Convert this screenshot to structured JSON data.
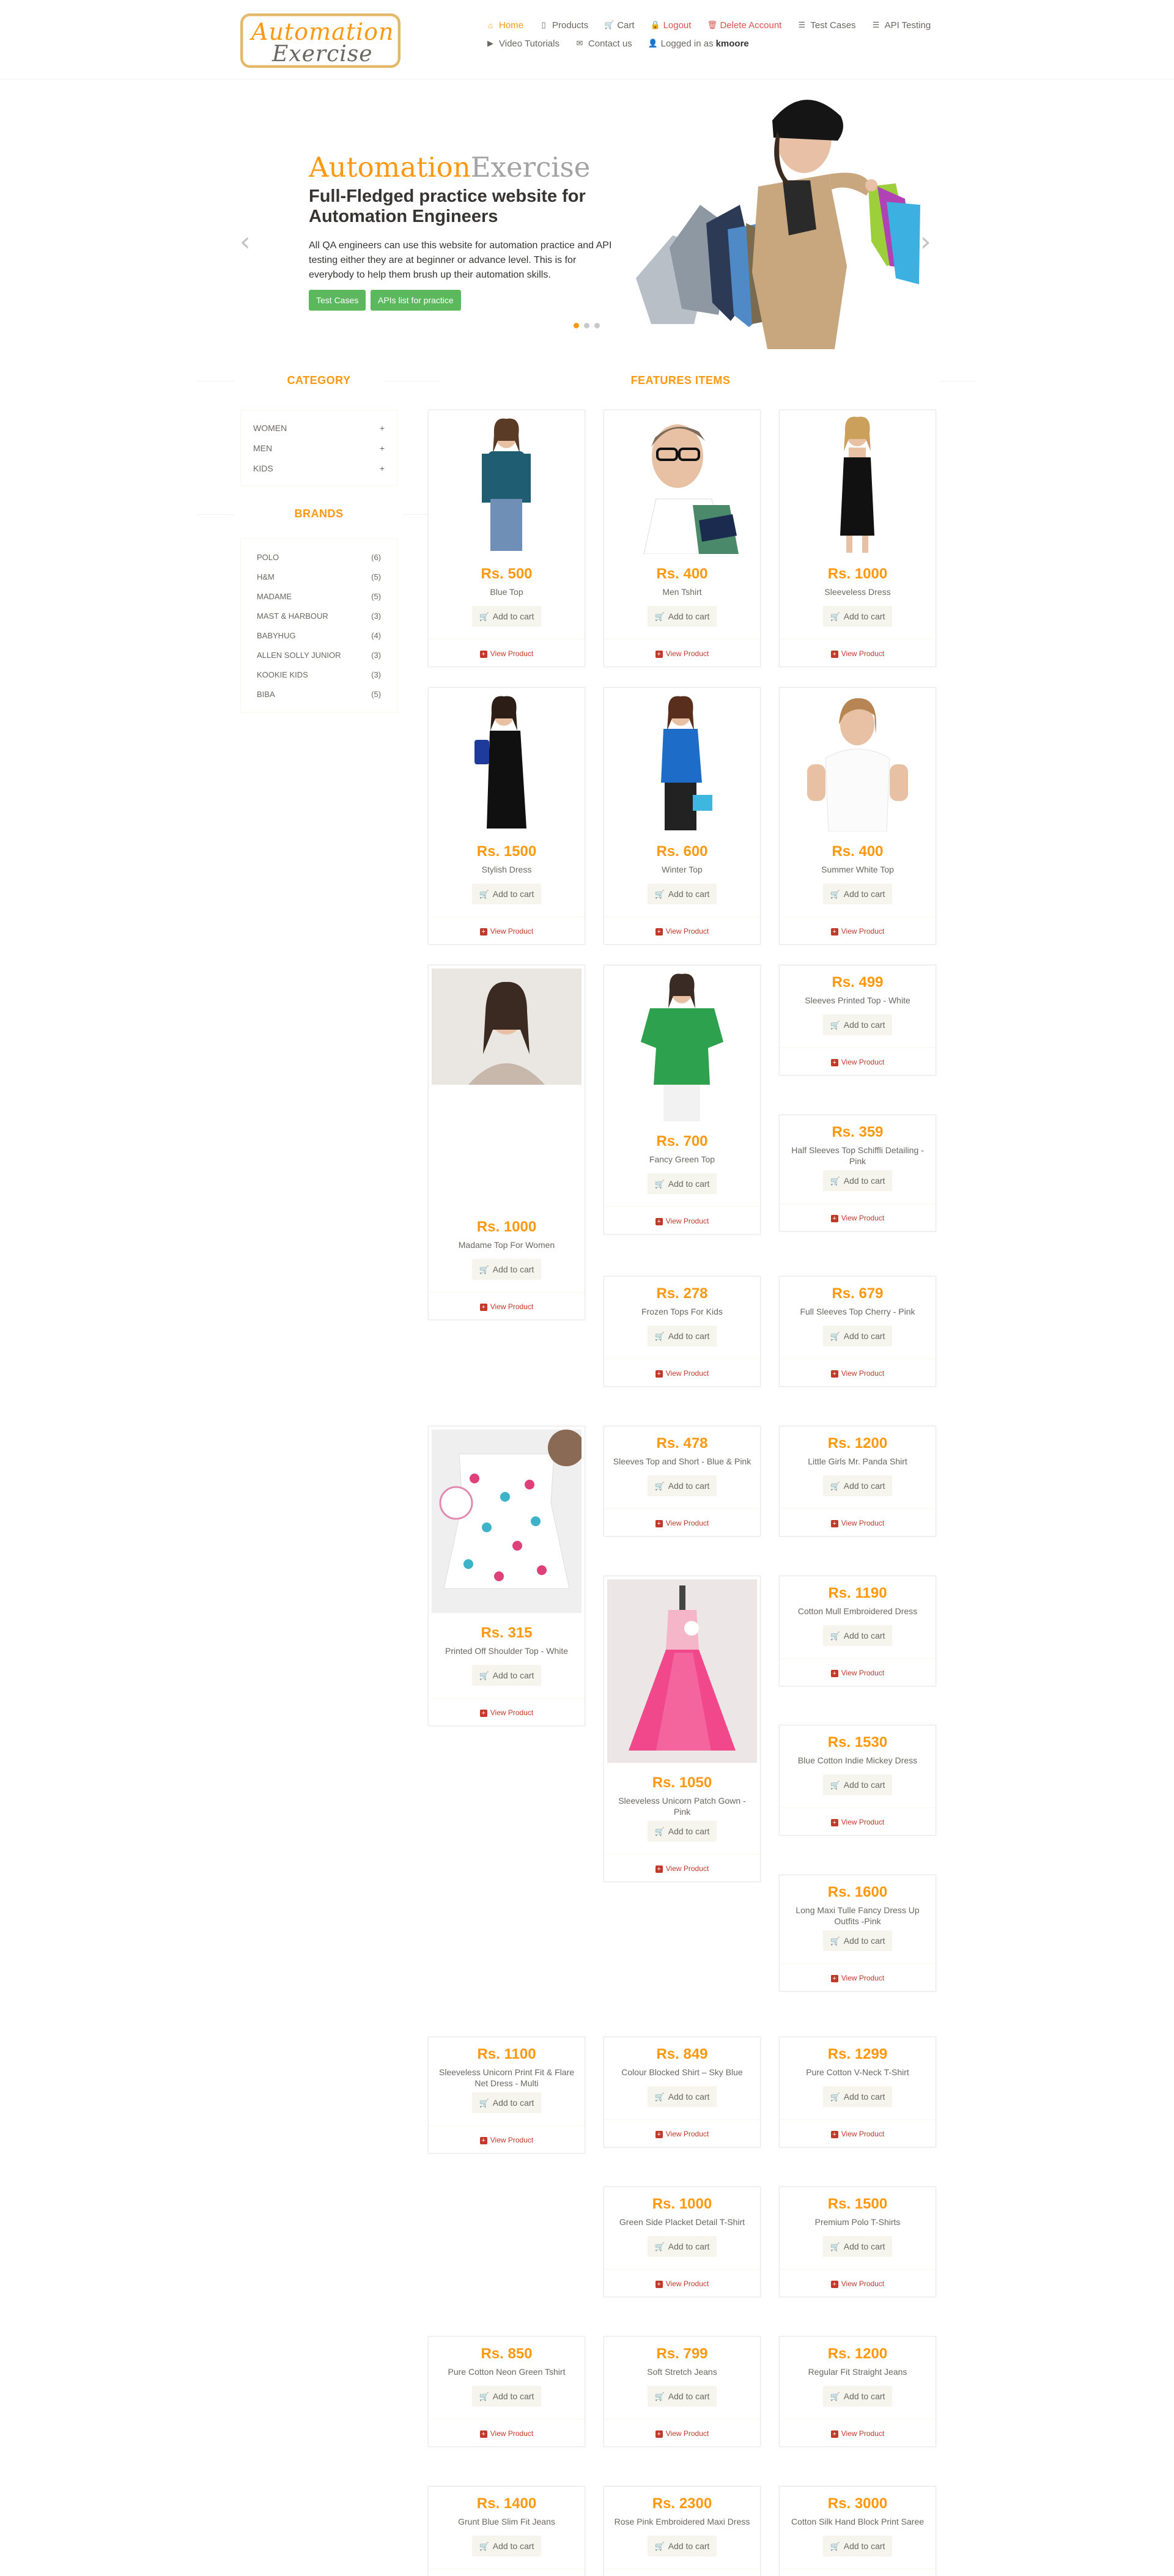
{
  "header": {
    "logo": {
      "line1": "Automation",
      "line2": "Exercise"
    },
    "nav": [
      {
        "label": "Home",
        "icon": "home-icon",
        "glyph": "⌂"
      },
      {
        "label": "Products",
        "icon": "shirt-icon",
        "glyph": "▯"
      },
      {
        "label": "Cart",
        "icon": "cart-icon",
        "glyph": "🛒"
      },
      {
        "label": "Logout",
        "icon": "lock-icon",
        "glyph": "🔒"
      },
      {
        "label": "Delete Account",
        "icon": "trash-icon",
        "glyph": "🗑"
      },
      {
        "label": "Test Cases",
        "icon": "list-icon",
        "glyph": "☰"
      },
      {
        "label": "API Testing",
        "icon": "list-icon",
        "glyph": "☰"
      },
      {
        "label": "Video Tutorials",
        "icon": "youtube-icon",
        "glyph": "▶"
      },
      {
        "label": "Contact us",
        "icon": "envelope-icon",
        "glyph": "✉"
      },
      {
        "label": "Logged in as",
        "icon": "user-icon",
        "glyph": "👤",
        "user": "kmoore"
      }
    ]
  },
  "slider": {
    "brand_a": "Automation",
    "brand_b": "Exercise",
    "heading": "Full-Fledged practice website for Automation Engineers",
    "text": "All QA engineers can use this website for automation practice and API testing either they are at beginner or advance level. This is for everybody to help them brush up their automation skills.",
    "btn_test_cases": "Test Cases",
    "btn_apis": "APIs list for practice",
    "prev_glyph": "‹",
    "next_glyph": "›"
  },
  "sidebar": {
    "category_title": "CATEGORY",
    "categories": [
      "WOMEN",
      "MEN",
      "KIDS"
    ],
    "plus_glyph": "+",
    "brands_title": "BRANDS",
    "brands": [
      {
        "name": "POLO",
        "count": "(6)"
      },
      {
        "name": "H&M",
        "count": "(5)"
      },
      {
        "name": "MADAME",
        "count": "(5)"
      },
      {
        "name": "MAST & HARBOUR",
        "count": "(3)"
      },
      {
        "name": "BABYHUG",
        "count": "(4)"
      },
      {
        "name": "ALLEN SOLLY JUNIOR",
        "count": "(3)"
      },
      {
        "name": "KOOKIE KIDS",
        "count": "(3)"
      },
      {
        "name": "BIBA",
        "count": "(5)"
      }
    ]
  },
  "features_title": "FEATURES ITEMS",
  "add_to_cart": "Add to cart",
  "view_product": "View Product",
  "products": [
    {
      "price": "Rs. 500",
      "name": "Blue Top"
    },
    {
      "price": "Rs. 400",
      "name": "Men Tshirt"
    },
    {
      "price": "Rs. 1000",
      "name": "Sleeveless Dress"
    },
    {
      "price": "Rs. 1500",
      "name": "Stylish Dress"
    },
    {
      "price": "Rs. 600",
      "name": "Winter Top"
    },
    {
      "price": "Rs. 400",
      "name": "Summer White Top"
    },
    {
      "price": "Rs. 1000",
      "name": "Madame Top For Women"
    },
    {
      "price": "Rs. 700",
      "name": "Fancy Green Top"
    },
    {
      "price": "Rs. 499",
      "name": "Sleeves Printed Top - White"
    },
    {
      "price": "Rs. 359",
      "name": "Half Sleeves Top Schiffli Detailing - Pink"
    },
    {
      "price": "Rs. 278",
      "name": "Frozen Tops For Kids"
    },
    {
      "price": "Rs. 679",
      "name": "Full Sleeves Top Cherry - Pink"
    },
    {
      "price": "Rs. 478",
      "name": "Sleeves Top and Short - Blue & Pink"
    },
    {
      "price": "Rs. 1200",
      "name": "Little Girls Mr. Panda Shirt"
    },
    {
      "price": "Rs. 315",
      "name": "Printed Off Shoulder Top - White"
    },
    {
      "price": "Rs. 1190",
      "name": "Cotton Mull Embroidered Dress"
    },
    {
      "price": "Rs. 1050",
      "name": "Sleeveless Unicorn Patch Gown - Pink"
    },
    {
      "price": "Rs. 1530",
      "name": "Blue Cotton Indie Mickey Dress"
    },
    {
      "price": "Rs. 1600",
      "name": "Long Maxi Tulle Fancy Dress Up Outfits -Pink"
    },
    {
      "price": "Rs. 1100",
      "name": "Sleeveless Unicorn Print Fit & Flare Net Dress - Multi"
    },
    {
      "price": "Rs. 849",
      "name": "Colour Blocked Shirt – Sky Blue"
    },
    {
      "price": "Rs. 1299",
      "name": "Pure Cotton V-Neck T-Shirt"
    },
    {
      "price": "Rs. 1000",
      "name": "Green Side Placket Detail T-Shirt"
    },
    {
      "price": "Rs. 1500",
      "name": "Premium Polo T-Shirts"
    },
    {
      "price": "Rs. 850",
      "name": "Pure Cotton Neon Green Tshirt"
    },
    {
      "price": "Rs. 799",
      "name": "Soft Stretch Jeans"
    },
    {
      "price": "Rs. 1200",
      "name": "Regular Fit Straight Jeans"
    },
    {
      "price": "Rs. 1400",
      "name": "Grunt Blue Slim Fit Jeans"
    },
    {
      "price": "Rs. 2300",
      "name": "Rose Pink Embroidered Maxi Dress"
    },
    {
      "price": "Rs. 3000",
      "name": "Cotton Silk Hand Block Print Saree"
    }
  ],
  "colors": {
    "accent": "#fe980f",
    "green": "#5cb85c",
    "danger": "#d9534f",
    "text": "#696763"
  }
}
